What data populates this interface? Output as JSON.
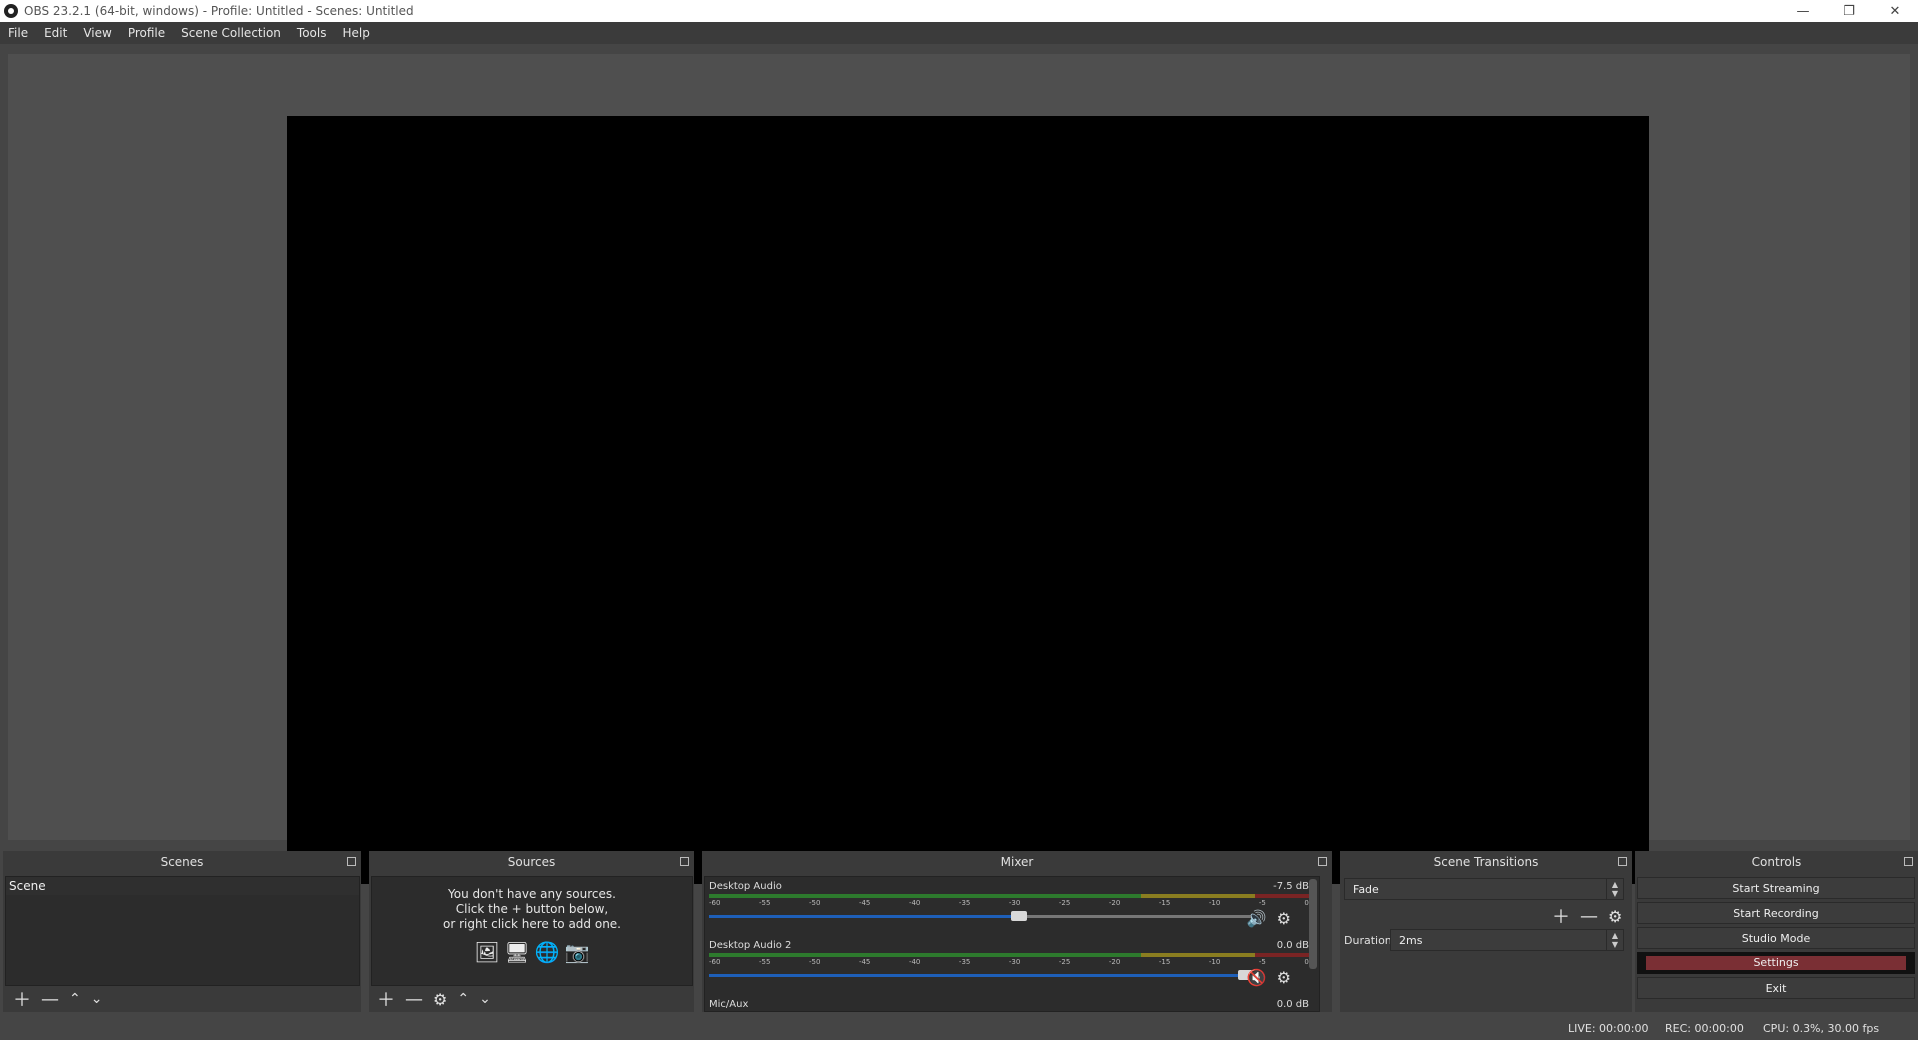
{
  "title_bar": {
    "title": "OBS 23.2.1 (64-bit, windows) - Profile: Untitled - Scenes: Untitled"
  },
  "window_controls": {
    "minimize": "—",
    "maximize": "❐",
    "close": "✕"
  },
  "menu": [
    "File",
    "Edit",
    "View",
    "Profile",
    "Scene Collection",
    "Tools",
    "Help"
  ],
  "docks": {
    "scenes": {
      "title": "Scenes",
      "items": [
        "Scene"
      ]
    },
    "sources": {
      "title": "Sources",
      "empty_line1": "You don't have any sources.",
      "empty_line2": "Click the + button below,",
      "empty_line3": "or right click here to add one."
    },
    "mixer": {
      "title": "Mixer",
      "ticks": [
        "-60",
        "-55",
        "-50",
        "-45",
        "-40",
        "-35",
        "-30",
        "-25",
        "-20",
        "-15",
        "-10",
        "-5",
        "0"
      ],
      "channels": [
        {
          "name": "Desktop Audio",
          "db": "-7.5 dB",
          "volume": 0.57,
          "muted": false
        },
        {
          "name": "Desktop Audio 2",
          "db": "0.0 dB",
          "volume": 1.0,
          "muted": true
        },
        {
          "name": "Mic/Aux",
          "db": "0.0 dB"
        }
      ]
    },
    "transitions": {
      "title": "Scene Transitions",
      "selected": "Fade",
      "duration_label": "Duration",
      "duration_value": "2ms"
    },
    "controls": {
      "title": "Controls",
      "start_streaming": "Start Streaming",
      "start_recording": "Start Recording",
      "studio_mode": "Studio Mode",
      "settings": "Settings",
      "exit": "Exit"
    }
  },
  "status": {
    "live": "LIVE: 00:00:00",
    "rec": "REC: 00:00:00",
    "cpu": "CPU: 0.3%, 30.00 fps"
  },
  "colors": {
    "panel": "#3a3a3a",
    "meter_green": "#2d7a2d",
    "meter_yellow": "#8a7d20",
    "meter_red": "#7a2424",
    "accent": "#1e5fb8",
    "muted": "#cc2222"
  }
}
